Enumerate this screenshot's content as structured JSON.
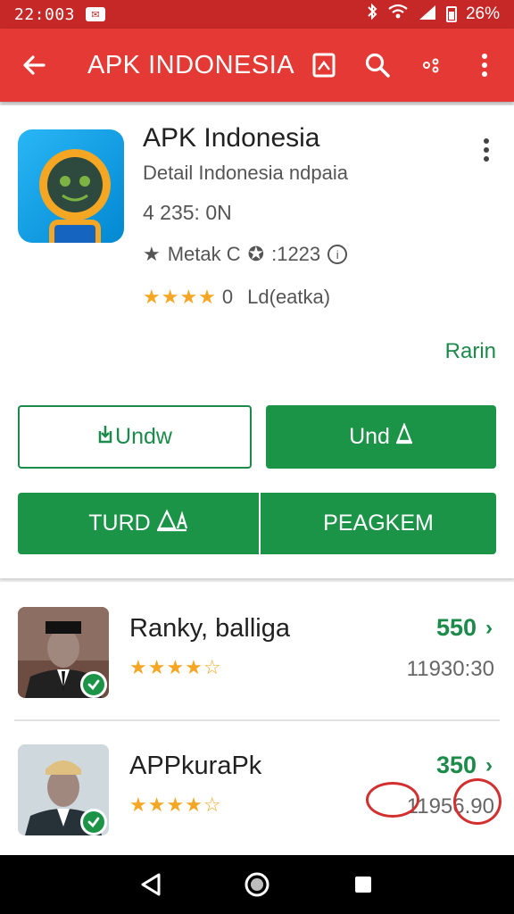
{
  "status_bar": {
    "time": "22:003",
    "battery": "26%"
  },
  "app_bar": {
    "title": "APK INDONESIA",
    "icons": [
      "arrow-back-icon",
      "bookmark-icon",
      "search-icon",
      "share-icon",
      "more-vert-icon"
    ]
  },
  "app": {
    "title": "APK Indonesia",
    "subtitle": "Detail Indonesia ndpaia",
    "size": "4 235: 0N",
    "meta_left": "Metak C",
    "meta_right": ":1223",
    "rating_value": "0",
    "rating_label": "Ld(eatka)",
    "rating_stars": 4,
    "link": "Rarin"
  },
  "buttons": {
    "outline": "Undw",
    "fill": "Und",
    "wide_left": "TURD",
    "wide_right": "PEAGKEM"
  },
  "list": [
    {
      "name": "Ranky, balliga",
      "price": "550",
      "count": "11930:30",
      "stars": 4
    },
    {
      "name": "APPkuraPk",
      "price": "350",
      "count": "11956.90",
      "stars": 4
    }
  ],
  "colors": {
    "app_bar": "#e53935",
    "status_bar": "#c62828",
    "accent_green": "#1b9447",
    "star": "#f5a623"
  }
}
